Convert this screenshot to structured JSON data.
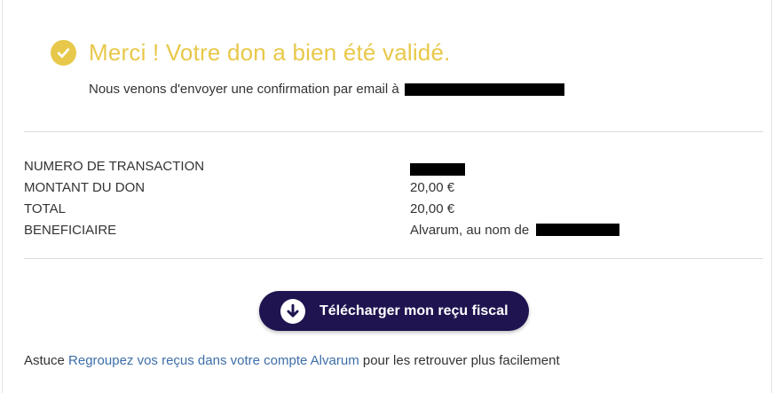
{
  "confirmation": {
    "title": "Merci ! Votre don a bien été validé.",
    "subtitle": "Nous venons d'envoyer une confirmation par email à"
  },
  "details": {
    "rows": [
      {
        "label": "NUMERO DE TRANSACTION",
        "value": ""
      },
      {
        "label": "MONTANT DU DON",
        "value": "20,00 €"
      },
      {
        "label": "TOTAL",
        "value": "20,00 €"
      },
      {
        "label": "BENEFICIAIRE",
        "value": "Alvarum, au nom de"
      }
    ]
  },
  "download": {
    "label": "Télécharger mon reçu fiscal"
  },
  "tip": {
    "prefix": "Astuce",
    "link": "Regroupez vos reçus dans votre compte Alvarum",
    "suffix": "pour les retrouver plus facilement"
  },
  "colors": {
    "accent": "#e8c84a",
    "button": "#1f1450",
    "link": "#3d6ea8"
  },
  "icons": {
    "success": "check-circle-icon",
    "download": "download-arrow-icon"
  }
}
